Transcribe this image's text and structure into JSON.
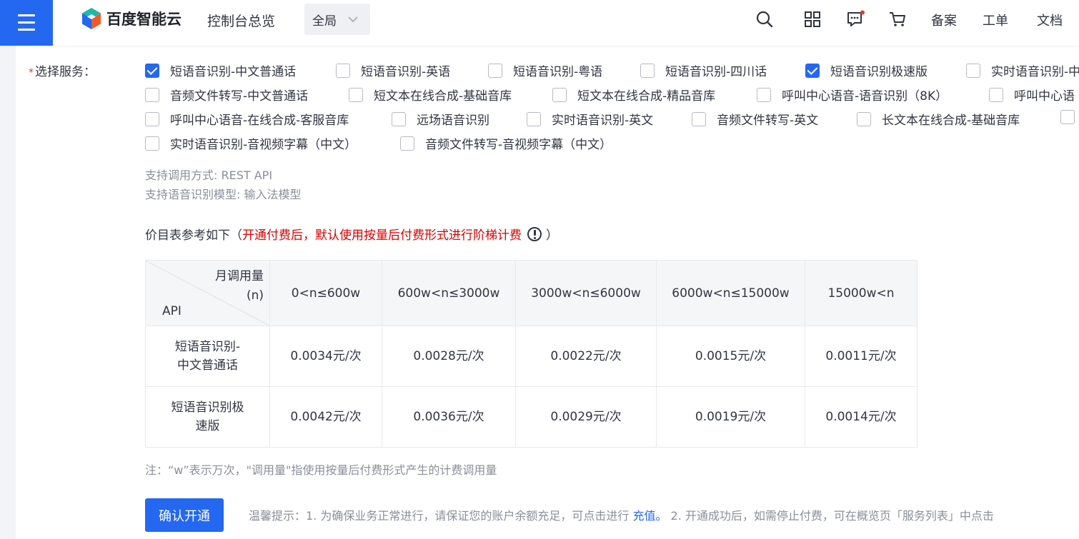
{
  "header": {
    "logo_text": "百度智能云",
    "console_title": "控制台总览",
    "region": "全局",
    "links": [
      "备案",
      "工单",
      "文档"
    ]
  },
  "form": {
    "service_label": "选择服务：",
    "services": [
      {
        "label": "短语音识别-中文普通话",
        "checked": true
      },
      {
        "label": "短语音识别-英语",
        "checked": false
      },
      {
        "label": "短语音识别-粤语",
        "checked": false
      },
      {
        "label": "短语音识别-四川话",
        "checked": false
      },
      {
        "label": "短语音识别极速版",
        "checked": true
      },
      {
        "label": "实时语音识别-中",
        "checked": false
      },
      {
        "label": "音频文件转写-中文普通话",
        "checked": false
      },
      {
        "label": "短文本在线合成-基础音库",
        "checked": false
      },
      {
        "label": "短文本在线合成-精品音库",
        "checked": false
      },
      {
        "label": "呼叫中心语音-语音识别（8K）",
        "checked": false
      },
      {
        "label": "呼叫中心语",
        "checked": false
      },
      {
        "label": "呼叫中心语音-在线合成-客服音库",
        "checked": false
      },
      {
        "label": "远场语音识别",
        "checked": false
      },
      {
        "label": "实时语音识别-英文",
        "checked": false
      },
      {
        "label": "音频文件转写-英文",
        "checked": false
      },
      {
        "label": "长文本在线合成-基础音库",
        "checked": false
      },
      {
        "label": "",
        "checked": false
      },
      {
        "label": "实时语音识别-音视频字幕（中文）",
        "checked": false
      },
      {
        "label": "音频文件转写-音视频字幕（中文）",
        "checked": false
      }
    ],
    "support_method": "支持调用方式: REST API",
    "support_model": "支持语音识别模型: 输入法模型"
  },
  "pricing": {
    "title_prefix": "价目表参考如下（",
    "title_red": "开通付费后，默认使用按量后付费形式进行阶梯计费",
    "title_suffix": "）",
    "corner_top_line1": "月调用量",
    "corner_top_line2": "(n)",
    "corner_bottom": "API",
    "tiers": [
      "0<n≤600w",
      "600w<n≤3000w",
      "3000w<n≤6000w",
      "6000w<n≤15000w",
      "15000w<n"
    ],
    "rows": [
      {
        "api_line1": "短语音识别-",
        "api_line2": "中文普通话",
        "prices": [
          "0.0034元/次",
          "0.0028元/次",
          "0.0022元/次",
          "0.0015元/次",
          "0.0011元/次"
        ]
      },
      {
        "api_line1": "短语音识别极",
        "api_line2": "速版",
        "prices": [
          "0.0042元/次",
          "0.0036元/次",
          "0.0029元/次",
          "0.0019元/次",
          "0.0014元/次"
        ]
      }
    ],
    "note": "注：“w”表示万次，\"调用量\"指使用按量后付费形式产生的计费调用量"
  },
  "footer": {
    "confirm_label": "确认开通",
    "tip_prefix": "温馨提示：1. 为确保业务正常进行，请保证您的账户余额充足，可点击进行 ",
    "tip_link": "充值。",
    "tip_suffix": " 2. 开通成功后，如需停止付费，可在概览页「服务列表」中点击"
  },
  "colors": {
    "accent": "#2468f2",
    "warning": "#d90000"
  }
}
